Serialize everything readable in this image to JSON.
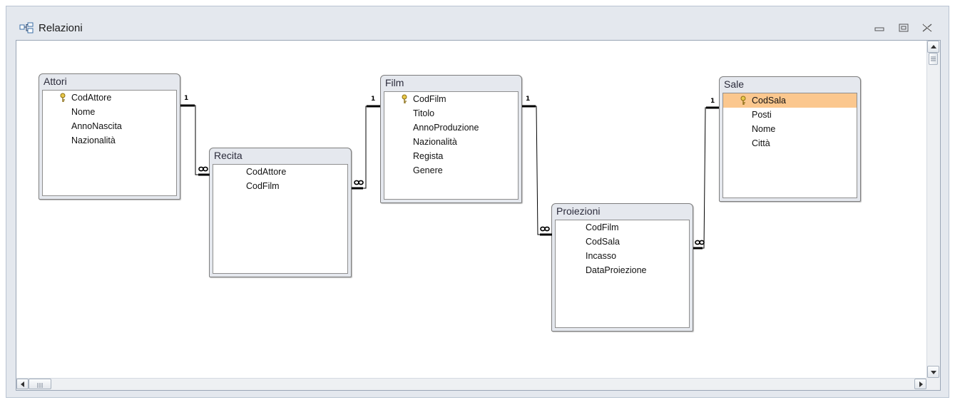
{
  "window": {
    "title": "Relazioni",
    "title_icon": "relationships-icon",
    "controls": [
      "minimize-icon",
      "restore-icon",
      "close-icon"
    ]
  },
  "tables": [
    {
      "id": "attori",
      "title": "Attori",
      "fields": [
        {
          "name": "CodAttore",
          "primary_key": true
        },
        {
          "name": "Nome",
          "primary_key": false
        },
        {
          "name": "AnnoNascita",
          "primary_key": false
        },
        {
          "name": "Nazionalità",
          "primary_key": false
        }
      ]
    },
    {
      "id": "recita",
      "title": "Recita",
      "fields": [
        {
          "name": "CodAttore",
          "primary_key": false
        },
        {
          "name": "CodFilm",
          "primary_key": false
        }
      ]
    },
    {
      "id": "film",
      "title": "Film",
      "fields": [
        {
          "name": "CodFilm",
          "primary_key": true
        },
        {
          "name": "Titolo",
          "primary_key": false
        },
        {
          "name": "AnnoProduzione",
          "primary_key": false
        },
        {
          "name": "Nazionalità",
          "primary_key": false
        },
        {
          "name": "Regista",
          "primary_key": false
        },
        {
          "name": "Genere",
          "primary_key": false
        }
      ]
    },
    {
      "id": "proiezioni",
      "title": "Proiezioni",
      "fields": [
        {
          "name": "CodFilm",
          "primary_key": false
        },
        {
          "name": "CodSala",
          "primary_key": false
        },
        {
          "name": "Incasso",
          "primary_key": false
        },
        {
          "name": "DataProiezione",
          "primary_key": false
        }
      ]
    },
    {
      "id": "sale",
      "title": "Sale",
      "fields": [
        {
          "name": "CodSala",
          "primary_key": true,
          "selected": true
        },
        {
          "name": "Posti",
          "primary_key": false
        },
        {
          "name": "Nome",
          "primary_key": false
        },
        {
          "name": "Città",
          "primary_key": false
        }
      ]
    }
  ],
  "relationships": [
    {
      "from": "Attori.CodAttore",
      "to": "Recita.CodAttore",
      "one": "1",
      "many": "∞"
    },
    {
      "from": "Film.CodFilm",
      "to": "Recita.CodFilm",
      "one": "1",
      "many": "∞"
    },
    {
      "from": "Film.CodFilm",
      "to": "Proiezioni.CodFilm",
      "one": "1",
      "many": "∞"
    },
    {
      "from": "Sale.CodSala",
      "to": "Proiezioni.CodSala",
      "one": "1",
      "many": "∞"
    }
  ],
  "colors": {
    "selected_field": "#fbc78e",
    "canvas": "#ffffff",
    "chrome": "#e4e8ee"
  }
}
